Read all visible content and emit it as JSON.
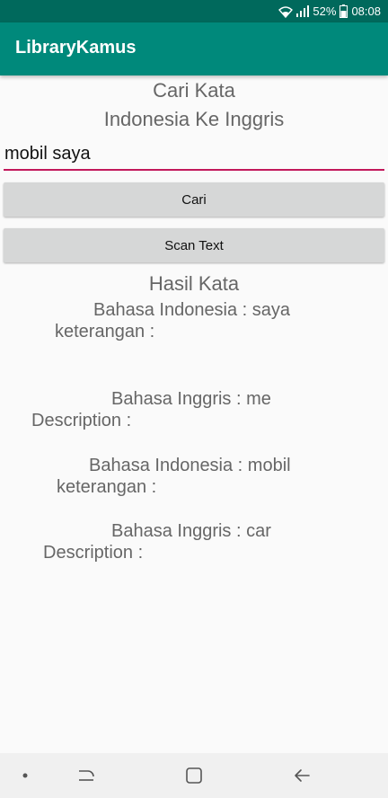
{
  "status_bar": {
    "battery": "52%",
    "time": "08:08",
    "icons": [
      "wifi-icon",
      "signal-icon",
      "battery-icon"
    ]
  },
  "app_bar": {
    "title": "LibraryKamus"
  },
  "main": {
    "heading": "Cari Kata",
    "subheading": "Indonesia Ke Inggris",
    "search_value": "mobil saya",
    "search_button": "Cari",
    "scan_button": "Scan Text",
    "results_heading": "Hasil Kata",
    "results": [
      {
        "word": "Bahasa Indonesia : saya",
        "note": "keterangan :"
      },
      {
        "word": "Bahasa Inggris : me",
        "note": "Description :"
      },
      {
        "word": "Bahasa Indonesia : mobil",
        "note": "keterangan :"
      },
      {
        "word": "Bahasa Inggris : car",
        "note": "Description :"
      }
    ]
  },
  "nav_bar": {
    "icons": [
      "dot-icon",
      "recent-apps-icon",
      "home-icon",
      "back-icon"
    ]
  },
  "colors": {
    "status_bar": "#00695c",
    "app_bar": "#00897b",
    "accent_underline": "#c2185b",
    "button": "#d6d7d7",
    "text_gray": "#666666"
  }
}
